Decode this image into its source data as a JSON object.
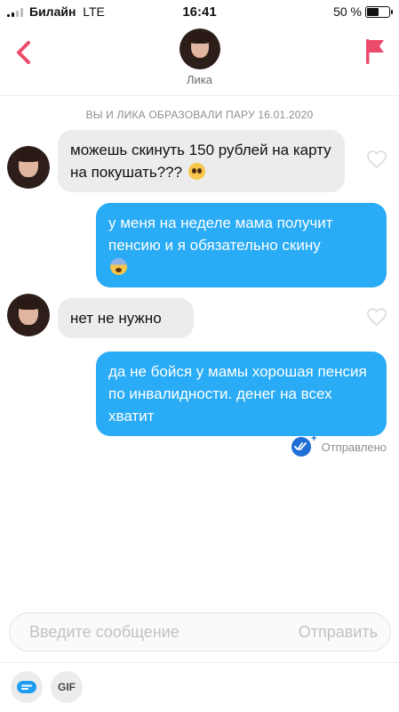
{
  "status_bar": {
    "carrier": "Билайн",
    "network": "LTE",
    "time": "16:41",
    "battery_percent_label": "50 %",
    "battery_level": 0.5
  },
  "header": {
    "contact_name": "Лика",
    "back_icon": "chevron-left-icon",
    "report_icon": "flag-icon",
    "accent_color": "#ec4a6b"
  },
  "conversation": {
    "match_notice": "ВЫ И ЛИКА ОБРАЗОВАЛИ ПАРУ 16.01.2020",
    "messages": [
      {
        "direction": "incoming",
        "text": "можешь скинуть 150 рублей на карту на покушать???",
        "emoji": "pleading-face"
      },
      {
        "direction": "outgoing",
        "text": "у меня на неделе мама получит пенсию и я обязательно скину",
        "emoji": "fearful-face"
      },
      {
        "direction": "incoming",
        "text": "нет не нужно"
      },
      {
        "direction": "outgoing",
        "text": "да не бойся у мамы хорошая пенсия по инвалидности. денег на всех хватит"
      }
    ],
    "delivery_status": "Отправлено"
  },
  "composer": {
    "placeholder": "Введите сообщение",
    "send_label": "Отправить"
  },
  "bottom_bar": {
    "gif_label": "GIF",
    "sticker_icon": "sticker-icon"
  },
  "colors": {
    "outgoing_bubble": "#29abf5",
    "incoming_bubble": "#ececec",
    "status_blue": "#1f6fd6"
  }
}
